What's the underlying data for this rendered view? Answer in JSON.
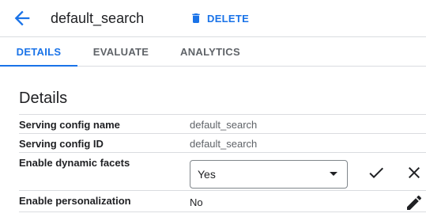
{
  "header": {
    "title": "default_search",
    "delete_label": "DELETE",
    "back_icon": "arrow-back-icon",
    "delete_icon": "trash-icon"
  },
  "tabs": [
    {
      "label": "DETAILS",
      "active": true
    },
    {
      "label": "EVALUATE",
      "active": false
    },
    {
      "label": "ANALYTICS",
      "active": false
    }
  ],
  "section": {
    "title": "Details",
    "rows": [
      {
        "label": "Serving config name",
        "value": "default_search"
      },
      {
        "label": "Serving config ID",
        "value": "default_search"
      },
      {
        "label": "Enable dynamic facets",
        "value": "Yes"
      },
      {
        "label": "Enable personalization",
        "value": "No"
      }
    ]
  },
  "icons": {
    "confirm": "check-icon",
    "cancel": "close-icon",
    "edit": "pencil-icon",
    "dropdown": "dropdown-arrow-icon"
  },
  "colors": {
    "accent": "#1a73e8",
    "divider": "#dadce0",
    "text_primary": "#202124",
    "text_secondary": "#5f6368"
  }
}
